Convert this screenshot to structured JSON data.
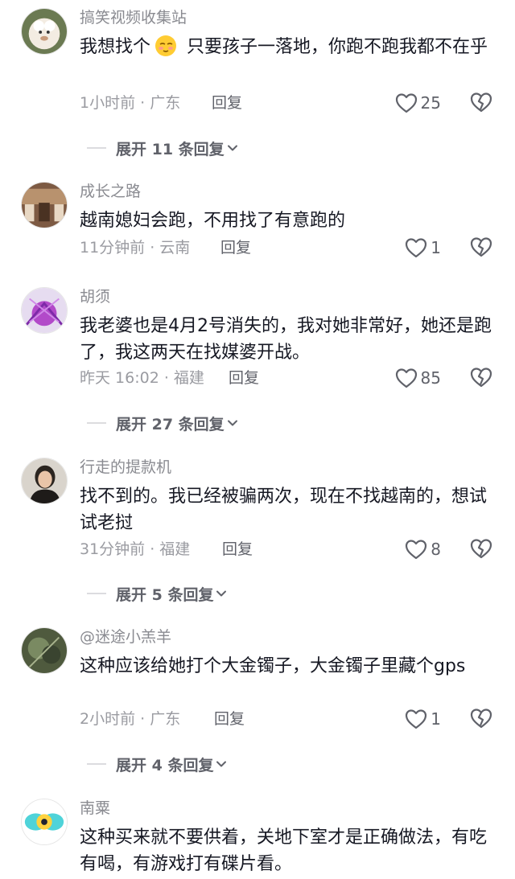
{
  "comments": [
    {
      "user": "搞笑视频收集站",
      "text_before": "我想找个",
      "text_after": " 只要孩子一落地，你跑不跑我都不在乎",
      "time": "1小时前 · 广东",
      "reply": "回复",
      "likes": "25",
      "expand": "展开 11 条回复"
    },
    {
      "user": "成长之路",
      "text": "越南媳妇会跑，不用找了有意跑的",
      "time": "11分钟前 · 云南",
      "reply": "回复",
      "likes": "1"
    },
    {
      "user": "胡须",
      "text": "我老婆也是4月2号消失的，我对她非常好，她还是跑了，我这两天在找媒婆开战。",
      "time": "昨天 16:02 · 福建",
      "reply": "回复",
      "likes": "85",
      "expand": "展开 27 条回复"
    },
    {
      "user": "行走的提款机",
      "text": "找不到的。我已经被骗两次，现在不找越南的，想试试老挝",
      "time": "31分钟前 · 福建",
      "reply": "回复",
      "likes": "8",
      "expand": "展开 5 条回复"
    },
    {
      "user": "@迷途小羔羊",
      "text": "这种应该给她打个大金镯子，大金镯子里藏个gps",
      "time": "2小时前 · 广东",
      "reply": "回复",
      "likes": "1",
      "expand": "展开 4 条回复"
    },
    {
      "user": "南粟",
      "text": "这种买来就不要供着，关地下室才是正确做法，有吃有喝，有游戏打有碟片看。"
    }
  ],
  "icons": {
    "like": "heart-outline-icon",
    "dislike": "broken-heart-icon",
    "expand": "chevron-down-icon",
    "emoji": "shy-face-emoji"
  },
  "colors": {
    "text": "#161823",
    "secondary": "#8a8b91",
    "meta": "#9a9ba1"
  }
}
